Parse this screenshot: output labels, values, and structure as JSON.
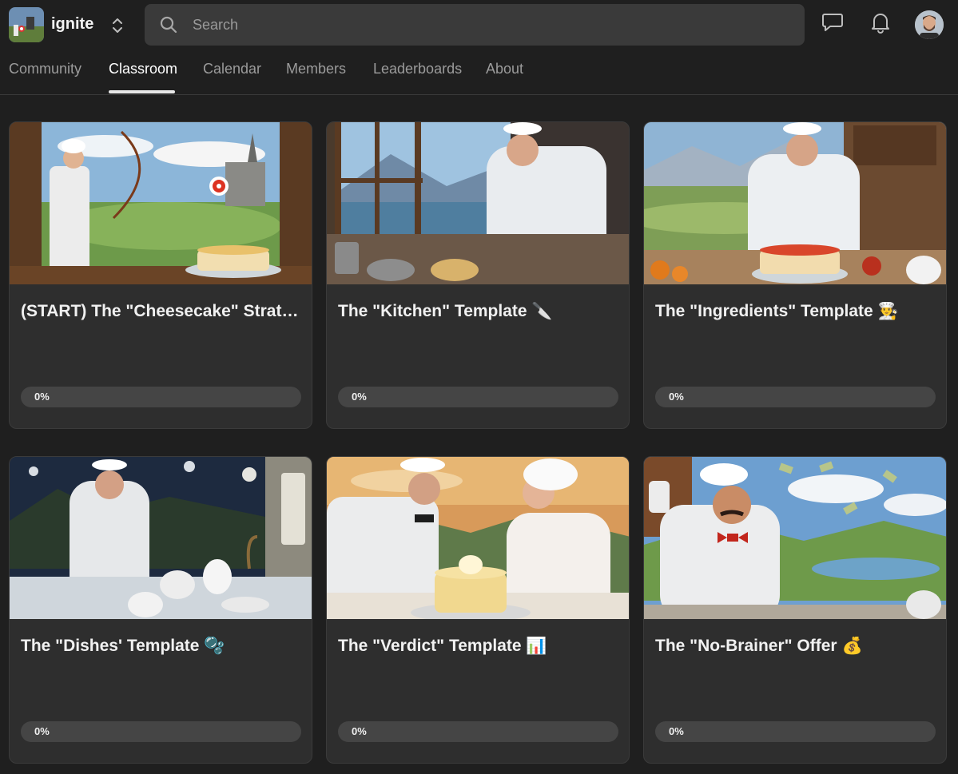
{
  "brand": {
    "name": "ignite"
  },
  "search": {
    "placeholder": "Search"
  },
  "tabs": [
    {
      "label": "Community"
    },
    {
      "label": "Classroom",
      "active": true
    },
    {
      "label": "Calendar"
    },
    {
      "label": "Members"
    },
    {
      "label": "Leaderboards"
    },
    {
      "label": "About"
    }
  ],
  "courses": [
    {
      "title": "(START) The \"Cheesecake\" Strategy",
      "progress_label": "0%",
      "progress": 0
    },
    {
      "title": "The \"Kitchen\" Template 🔪",
      "progress_label": "0%",
      "progress": 0
    },
    {
      "title": "The \"Ingredients\" Template 👨‍🍳",
      "progress_label": "0%",
      "progress": 0
    },
    {
      "title": "The \"Dishes' Template 🫧",
      "progress_label": "0%",
      "progress": 0
    },
    {
      "title": "The \"Verdict\" Template 📊",
      "progress_label": "0%",
      "progress": 0
    },
    {
      "title": "The \"No-Brainer\" Offer 💰",
      "progress_label": "0%",
      "progress": 0
    }
  ],
  "icons": {
    "switcher": "chevron-up-down-icon",
    "search": "search-icon",
    "chat": "chat-icon",
    "notifications": "bell-icon"
  },
  "colors": {
    "background": "#1f1f1f",
    "card": "#2e2e2e",
    "search": "#3a3a3a",
    "progress_track": "#454545"
  }
}
